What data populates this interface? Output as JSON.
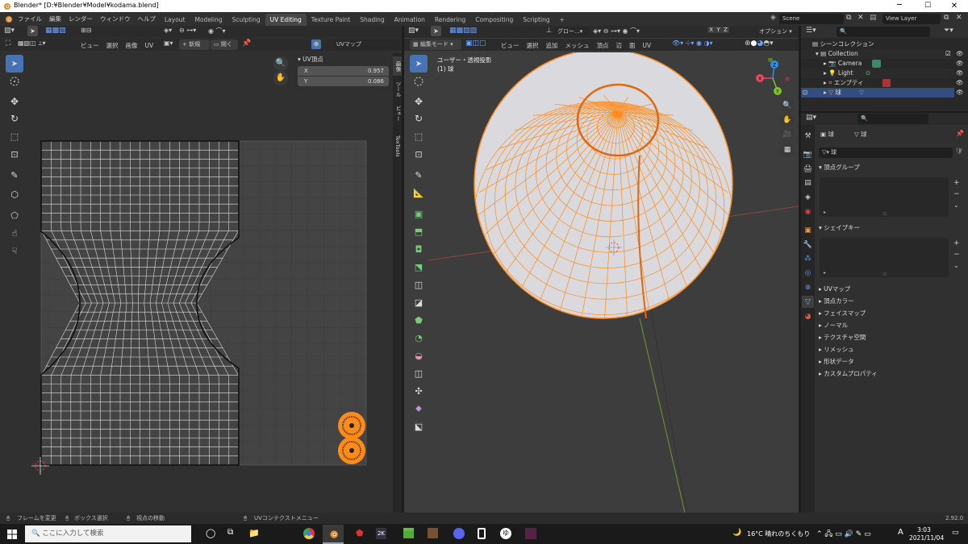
{
  "window": {
    "title": "Blender* [D:¥Blender¥Model¥kodama.blend]"
  },
  "menubar": {
    "items": [
      "ファイル",
      "編集",
      "レンダー",
      "ウィンドウ",
      "ヘルプ"
    ]
  },
  "workspaces": [
    "Layout",
    "Modeling",
    "Sculpting",
    "UV Editing",
    "Texture Paint",
    "Shading",
    "Animation",
    "Rendering",
    "Compositing",
    "Scripting"
  ],
  "workspace_active": "UV Editing",
  "scene": {
    "label": "Scene",
    "view_layer": "View Layer"
  },
  "uv_editor": {
    "menu": [
      "ビュー",
      "選択",
      "画像",
      "UV"
    ],
    "new_label": "新規",
    "open_label": "開く",
    "uvmap_label": "UVマップ",
    "npanel": {
      "title": "UV頂点",
      "x_label": "X",
      "x_value": "0.957",
      "y_label": "Y",
      "y_value": "0.086"
    },
    "sidetabs": [
      "画像",
      "ツール",
      "ビュー",
      "TexTools"
    ]
  },
  "viewport": {
    "mode": "編集モード",
    "menu": [
      "ビュー",
      "選択",
      "追加",
      "メッシュ",
      "頂点",
      "辺",
      "面",
      "UV"
    ],
    "transform": "グロー...",
    "options": "オプション",
    "axes": [
      "X",
      "Y",
      "Z"
    ],
    "overlay_title": "ユーザー・透視投影",
    "overlay_object": "(1) 球",
    "gizmo": [
      "X",
      "Y",
      "Z"
    ]
  },
  "outliner": {
    "title": "シーンコレクション",
    "items": [
      {
        "label": "Collection"
      },
      {
        "label": "Camera"
      },
      {
        "label": "Light"
      },
      {
        "label": "エンプティ"
      },
      {
        "label": "球"
      }
    ]
  },
  "properties": {
    "object": "球",
    "data": "球",
    "mesh": "球",
    "sections": [
      "頂点グループ",
      "シェイプキー"
    ],
    "collapsed": [
      "UVマップ",
      "頂点カラー",
      "フェイスマップ",
      "ノーマル",
      "テクスチャ空間",
      "リメッシュ",
      "形状データ",
      "カスタムプロパティ"
    ]
  },
  "statusbar": {
    "items": [
      "フレームを変更",
      "ボックス選択",
      "視点の移動",
      "UVコンテクストメニュー"
    ],
    "version": "2.92.0"
  },
  "taskbar": {
    "search": "ここに入力して検索",
    "weather": "16°C 晴れのちくもり",
    "ime": "A",
    "time": "3:03",
    "date": "2021/11/04"
  },
  "colors": {
    "accent": "#4772b3",
    "orange": "#ff8c1a",
    "bg": "#303030",
    "grid": "#3d3d3d"
  }
}
